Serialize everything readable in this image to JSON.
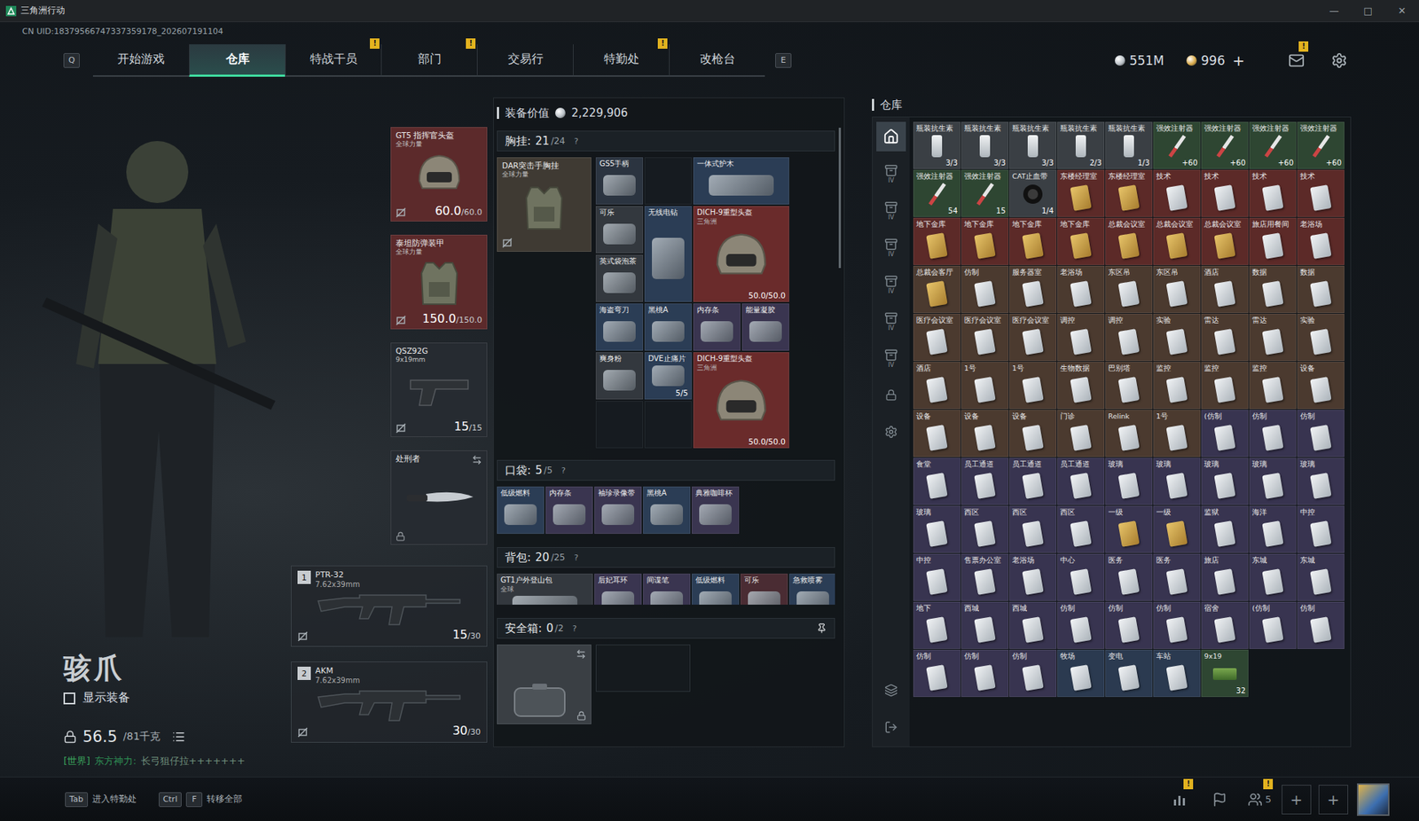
{
  "window": {
    "title": "三角洲行动",
    "controls": [
      "—",
      "□",
      "✕"
    ]
  },
  "uid": "CN UID:18379566747337359178_202607191104",
  "nav": {
    "left_key": "Q",
    "right_key": "E",
    "badge_text": "!",
    "tabs": [
      {
        "label": "开始游戏",
        "selected": false,
        "badge": false
      },
      {
        "label": "仓库",
        "selected": true,
        "badge": false
      },
      {
        "label": "特战干员",
        "selected": false,
        "badge": true
      },
      {
        "label": "部门",
        "selected": false,
        "badge": true
      },
      {
        "label": "交易行",
        "selected": false,
        "badge": false
      },
      {
        "label": "特勤处",
        "selected": false,
        "badge": true
      },
      {
        "label": "改枪台",
        "selected": false,
        "badge": false
      }
    ]
  },
  "currency": {
    "silver": "551M",
    "gold": "996",
    "add": "+"
  },
  "mail": {
    "badge": true
  },
  "operator": {
    "name": "骇爪",
    "show_gear": {
      "label": "显示装备",
      "checked": false
    },
    "weight": "56.5",
    "weight_max": "/81千克",
    "chat": {
      "channel": "[世界]",
      "sender": "东方神力:",
      "message": "长弓狙仔拉+++++++"
    }
  },
  "gear_slots": [
    {
      "name": "GT5 指挥官头盔",
      "sub": "全球力量",
      "value": "60.0",
      "max": "/60.0",
      "kind": "helmet",
      "color": "#5c2a2b"
    },
    {
      "name": "泰坦防弹装甲",
      "sub": "全球力量",
      "value": "150.0",
      "max": "/150.0",
      "kind": "armor",
      "color": "#5c2a2b"
    },
    {
      "name": "QSZ92G",
      "sub": "9x19mm",
      "value": "15",
      "max": "/15",
      "kind": "pistol",
      "color": "#262b31"
    },
    {
      "name": "处刑者",
      "kind": "melee",
      "color": "#262b31"
    }
  ],
  "guns": [
    {
      "index": "1",
      "name": "PTR-32",
      "caliber": "7.62x39mm",
      "ammo": "15",
      "max": "/30"
    },
    {
      "index": "2",
      "name": "AKM",
      "caliber": "7.62x39mm",
      "ammo": "30",
      "max": "/30"
    }
  ],
  "loadout": {
    "value_label": "装备价值",
    "value": "2,229,906",
    "help": "?",
    "chest": {
      "label": "胸挂:",
      "count": "21",
      "capacity": "/24",
      "rig": {
        "name": "DAR突击手胸挂",
        "sub": "全球力量",
        "color": "#3f3a33"
      },
      "items": [
        {
          "label": "GS5手柄",
          "shape": "1x1",
          "kind": "item",
          "color": "#2b3440"
        },
        {
          "kind": "empty",
          "shape": "1x1"
        },
        {
          "label": "一体式护木",
          "shape": "2x1",
          "kind": "item",
          "color": "#2b3d55"
        },
        {
          "label": "可乐",
          "shape": "1x1",
          "kind": "item",
          "color": "#33383e"
        },
        {
          "label": "无线电钻",
          "shape": "1x2",
          "kind": "item",
          "color": "#2b3d55"
        },
        {
          "label": "DICH-9重型头盔",
          "sub": "三角洲",
          "value": "50.0/50.0",
          "shape": "2x2",
          "kind": "helmet",
          "color": "#6a2b2b"
        },
        {
          "label": "英式袋泡茶",
          "shape": "1x1",
          "kind": "item",
          "color": "#33383e"
        },
        {
          "label": "海盗弯刀",
          "shape": "1x1",
          "kind": "item",
          "color": "#2b3d55"
        },
        {
          "label": "黑桃A",
          "shape": "1x1",
          "kind": "item",
          "color": "#2b3d55"
        },
        {
          "label": "内存条",
          "shape": "1x1",
          "kind": "item",
          "color": "#3a3550"
        },
        {
          "label": "能量凝胶",
          "shape": "1x1",
          "kind": "item",
          "color": "#3a3550"
        },
        {
          "label": "爽身粉",
          "shape": "1x1",
          "kind": "item",
          "color": "#33383e"
        },
        {
          "label": "DVE止痛片",
          "value": "5/5",
          "shape": "1x1",
          "kind": "item",
          "color": "#2b3d55"
        },
        {
          "label": "DICH-9重型头盔",
          "sub": "三角洲",
          "value": "50.0/50.0",
          "shape": "2x2",
          "kind": "helmet",
          "color": "#6a2b2b"
        },
        {
          "kind": "empty",
          "shape": "1x1"
        },
        {
          "kind": "empty",
          "shape": "1x1"
        }
      ]
    },
    "pocket": {
      "label": "口袋:",
      "count": "5",
      "capacity": "/5",
      "items": [
        {
          "label": "低级燃料",
          "shape": "1x1",
          "kind": "item",
          "color": "#2b3d55"
        },
        {
          "label": "内存条",
          "shape": "1x1",
          "kind": "item",
          "color": "#3a3550"
        },
        {
          "label": "袖珍录像带",
          "shape": "1x1",
          "kind": "item",
          "color": "#3a3550"
        },
        {
          "label": "黑桃A",
          "shape": "1x1",
          "kind": "item",
          "color": "#2b3d55"
        },
        {
          "label": "典雅咖啡杯",
          "shape": "1x1",
          "kind": "item",
          "color": "#3a3550"
        }
      ]
    },
    "backpack": {
      "label": "背包:",
      "count": "20",
      "capacity": "/25",
      "items": [
        {
          "label": "GT1户外登山包",
          "sub": "全球",
          "shape": "2x1",
          "kind": "item",
          "color": "#33383e"
        },
        {
          "label": "后妃耳环",
          "shape": "1x1",
          "kind": "item",
          "color": "#3a3550"
        },
        {
          "label": "间谍笔",
          "shape": "1x1",
          "kind": "item",
          "color": "#3a3550"
        },
        {
          "label": "低级燃料",
          "shape": "1x1",
          "kind": "item",
          "color": "#2b3d55"
        },
        {
          "label": "可乐",
          "shape": "1x1",
          "kind": "item",
          "color": "#4a2c33"
        },
        {
          "label": "急救喷雾",
          "shape": "1x1",
          "kind": "item",
          "color": "#2b3d55"
        }
      ]
    },
    "safebox": {
      "label": "安全箱:",
      "count": "0",
      "capacity": "/2"
    }
  },
  "warehouse": {
    "title": "仓库",
    "sidebar": [
      {
        "kind": "home",
        "selected": true
      },
      {
        "kind": "tab",
        "label": "IV",
        "selected": false
      },
      {
        "kind": "tab",
        "label": "IV",
        "selected": false
      },
      {
        "kind": "tab",
        "label": "IV",
        "selected": false
      },
      {
        "kind": "tab",
        "label": "IV",
        "selected": false
      },
      {
        "kind": "tab",
        "label": "IV",
        "selected": false
      },
      {
        "kind": "tab",
        "label": "IV",
        "selected": false
      },
      {
        "kind": "lock",
        "selected": false
      },
      {
        "kind": "settings",
        "selected": false
      }
    ],
    "tools": [
      {
        "kind": "layers"
      },
      {
        "kind": "exit"
      }
    ],
    "items": [
      {
        "label": "瓶装抗生素",
        "count": "3/3",
        "kind": "bottle",
        "color": "#3a3f44"
      },
      {
        "label": "瓶装抗生素",
        "count": "3/3",
        "kind": "bottle",
        "color": "#3a3f44"
      },
      {
        "label": "瓶装抗生素",
        "count": "3/3",
        "kind": "bottle",
        "color": "#3a3f44"
      },
      {
        "label": "瓶装抗生素",
        "count": "2/3",
        "kind": "bottle",
        "color": "#3a3f44"
      },
      {
        "label": "瓶装抗生素",
        "count": "1/3",
        "kind": "bottle",
        "color": "#3a3f44"
      },
      {
        "label": "强效注射器",
        "count": "+60",
        "kind": "syringe",
        "color": "#2e4632"
      },
      {
        "label": "强效注射器",
        "count": "+60",
        "kind": "syringe",
        "color": "#2e4632"
      },
      {
        "label": "强效注射器",
        "count": "+60",
        "kind": "syringe",
        "color": "#2e4632"
      },
      {
        "label": "强效注射器",
        "count": "+60",
        "kind": "syringe",
        "color": "#2e4632"
      },
      {
        "label": "强效注射器",
        "count": "54",
        "kind": "syringe",
        "color": "#2e4632"
      },
      {
        "label": "强效注射器",
        "count": "15",
        "kind": "syringe",
        "color": "#2e4632"
      },
      {
        "label": "CAT止血带",
        "count": "1/4",
        "kind": "tourniquet",
        "color": "#3a3f44"
      },
      {
        "label": "东楼经理室",
        "kind": "gold-card",
        "color": "#5c2a28"
      },
      {
        "label": "东楼经理室",
        "kind": "gold-card",
        "color": "#5c2a28"
      },
      {
        "label": "技术",
        "kind": "card",
        "color": "#5c2a28"
      },
      {
        "label": "技术",
        "kind": "card",
        "color": "#5c2a28"
      },
      {
        "label": "技术",
        "kind": "card",
        "color": "#5c2a28"
      },
      {
        "label": "技术",
        "kind": "card",
        "color": "#5c2a28"
      },
      {
        "label": "地下金库",
        "kind": "gold-card",
        "color": "#5c2a28"
      },
      {
        "label": "地下金库",
        "kind": "gold-card",
        "color": "#5c2a28"
      },
      {
        "label": "地下金库",
        "kind": "gold-card",
        "color": "#5c2a28"
      },
      {
        "label": "地下金库",
        "kind": "gold-card",
        "color": "#5c2a28"
      },
      {
        "label": "总裁会议室",
        "kind": "gold-card",
        "color": "#5c2a28"
      },
      {
        "label": "总裁会议室",
        "kind": "gold-card",
        "color": "#5c2a28"
      },
      {
        "label": "总裁会议室",
        "kind": "gold-card",
        "color": "#5c2a28"
      },
      {
        "label": "旅店用餐间",
        "kind": "card",
        "color": "#5c2a28"
      },
      {
        "label": "老浴场",
        "kind": "card",
        "color": "#5c2a28"
      },
      {
        "label": "总裁会客厅",
        "kind": "gold-card",
        "color": "#4b3a2f"
      },
      {
        "label": "仿制",
        "kind": "card",
        "color": "#4b3a2f"
      },
      {
        "label": "服务器室",
        "kind": "card",
        "color": "#4b3a2f"
      },
      {
        "label": "老浴场",
        "kind": "card",
        "color": "#4b3a2f"
      },
      {
        "label": "东区吊",
        "kind": "card",
        "color": "#4b3a2f"
      },
      {
        "label": "东区吊",
        "kind": "card",
        "color": "#4b3a2f"
      },
      {
        "label": "酒店",
        "kind": "card",
        "color": "#4b3a2f"
      },
      {
        "label": "数据",
        "kind": "card",
        "color": "#4b3a2f"
      },
      {
        "label": "数据",
        "kind": "card",
        "color": "#4b3a2f"
      },
      {
        "label": "医疗会议室",
        "kind": "card",
        "color": "#4b3a2f"
      },
      {
        "label": "医疗会议室",
        "kind": "card",
        "color": "#4b3a2f"
      },
      {
        "label": "医疗会议室",
        "kind": "card",
        "color": "#4b3a2f"
      },
      {
        "label": "调控",
        "kind": "card",
        "color": "#4b3a2f"
      },
      {
        "label": "调控",
        "kind": "card",
        "color": "#4b3a2f"
      },
      {
        "label": "实验",
        "kind": "card",
        "color": "#4b3a2f"
      },
      {
        "label": "雷达",
        "kind": "card",
        "color": "#4b3a2f"
      },
      {
        "label": "雷达",
        "kind": "card",
        "color": "#4b3a2f"
      },
      {
        "label": "实验",
        "kind": "card",
        "color": "#4b3a2f"
      },
      {
        "label": "酒店",
        "kind": "card",
        "color": "#4b3a2f"
      },
      {
        "label": "1号",
        "kind": "card",
        "color": "#4b3a2f"
      },
      {
        "label": "1号",
        "kind": "card",
        "color": "#4b3a2f"
      },
      {
        "label": "生物数据",
        "kind": "card",
        "color": "#4b3a2f"
      },
      {
        "label": "巴别塔",
        "kind": "card",
        "color": "#4b3a2f"
      },
      {
        "label": "监控",
        "kind": "card",
        "color": "#4b3a2f"
      },
      {
        "label": "监控",
        "kind": "card",
        "color": "#4b3a2f"
      },
      {
        "label": "监控",
        "kind": "card",
        "color": "#4b3a2f"
      },
      {
        "label": "设备",
        "kind": "card",
        "color": "#4b3a2f"
      },
      {
        "label": "设备",
        "kind": "card",
        "color": "#4b3a2f"
      },
      {
        "label": "设备",
        "kind": "card",
        "color": "#4b3a2f"
      },
      {
        "label": "设备",
        "kind": "card",
        "color": "#4b3a2f"
      },
      {
        "label": "门诊",
        "kind": "card",
        "color": "#4b3a2f"
      },
      {
        "label": "Relink",
        "kind": "card",
        "color": "#4b3a2f"
      },
      {
        "label": "1号",
        "kind": "card",
        "color": "#4b3a2f"
      },
      {
        "label": "(仿制",
        "kind": "card",
        "color": "#383450"
      },
      {
        "label": "仿制",
        "kind": "card",
        "color": "#383450"
      },
      {
        "label": "仿制",
        "kind": "card",
        "color": "#383450"
      },
      {
        "label": "食堂",
        "kind": "card",
        "color": "#383450"
      },
      {
        "label": "员工通道",
        "kind": "card",
        "color": "#383450"
      },
      {
        "label": "员工通道",
        "kind": "card",
        "color": "#383450"
      },
      {
        "label": "员工通道",
        "kind": "card",
        "color": "#383450"
      },
      {
        "label": "玻璃",
        "kind": "card",
        "color": "#383450"
      },
      {
        "label": "玻璃",
        "kind": "card",
        "color": "#383450"
      },
      {
        "label": "玻璃",
        "kind": "card",
        "color": "#383450"
      },
      {
        "label": "玻璃",
        "kind": "card",
        "color": "#383450"
      },
      {
        "label": "玻璃",
        "kind": "card",
        "color": "#383450"
      },
      {
        "label": "玻璃",
        "kind": "card",
        "color": "#383450"
      },
      {
        "label": "西区",
        "kind": "card",
        "color": "#383450"
      },
      {
        "label": "西区",
        "kind": "card",
        "color": "#383450"
      },
      {
        "label": "西区",
        "kind": "card",
        "color": "#383450"
      },
      {
        "label": "一级",
        "kind": "gold-card",
        "color": "#383450"
      },
      {
        "label": "一级",
        "kind": "gold-card",
        "color": "#383450"
      },
      {
        "label": "监狱",
        "kind": "card",
        "color": "#383450"
      },
      {
        "label": "海洋",
        "kind": "card",
        "color": "#383450"
      },
      {
        "label": "中控",
        "kind": "card",
        "color": "#383450"
      },
      {
        "label": "中控",
        "kind": "card",
        "color": "#383450"
      },
      {
        "label": "售票办公室",
        "kind": "card",
        "color": "#383450"
      },
      {
        "label": "老浴场",
        "kind": "card",
        "color": "#383450"
      },
      {
        "label": "中心",
        "kind": "card",
        "color": "#383450"
      },
      {
        "label": "医务",
        "kind": "card",
        "color": "#383450"
      },
      {
        "label": "医务",
        "kind": "card",
        "color": "#383450"
      },
      {
        "label": "旅店",
        "kind": "card",
        "color": "#383450"
      },
      {
        "label": "东城",
        "kind": "card",
        "color": "#383450"
      },
      {
        "label": "东城",
        "kind": "card",
        "color": "#383450"
      },
      {
        "label": "地下",
        "kind": "card",
        "color": "#383450"
      },
      {
        "label": "西城",
        "kind": "card",
        "color": "#383450"
      },
      {
        "label": "西城",
        "kind": "card",
        "color": "#383450"
      },
      {
        "label": "仿制",
        "kind": "card",
        "color": "#383450"
      },
      {
        "label": "仿制",
        "kind": "card",
        "color": "#383450"
      },
      {
        "label": "仿制",
        "kind": "card",
        "color": "#383450"
      },
      {
        "label": "宿舍",
        "kind": "card",
        "color": "#383450"
      },
      {
        "label": "(仿制",
        "kind": "card",
        "color": "#383450"
      },
      {
        "label": "仿制",
        "kind": "card",
        "color": "#383450"
      },
      {
        "label": "仿制",
        "kind": "card",
        "color": "#383450"
      },
      {
        "label": "仿制",
        "kind": "card",
        "color": "#383450"
      },
      {
        "label": "仿制",
        "kind": "card",
        "color": "#383450"
      },
      {
        "label": "牧场",
        "kind": "card",
        "color": "#2b3a50"
      },
      {
        "label": "变电",
        "kind": "card",
        "color": "#2b3a50"
      },
      {
        "label": "车站",
        "kind": "card",
        "color": "#2b3a50"
      },
      {
        "label": "9x19",
        "count": "32",
        "kind": "ammo",
        "color": "#2e4632"
      }
    ]
  },
  "bottom": {
    "hints": [
      {
        "keys": [
          "Tab"
        ],
        "label": "进入特勤处"
      },
      {
        "keys": [
          "Ctrl",
          "F"
        ],
        "label": "转移全部"
      }
    ],
    "chart_badge": true,
    "friends": "5",
    "friends_badge": true,
    "slots": [
      "+",
      "+"
    ]
  }
}
